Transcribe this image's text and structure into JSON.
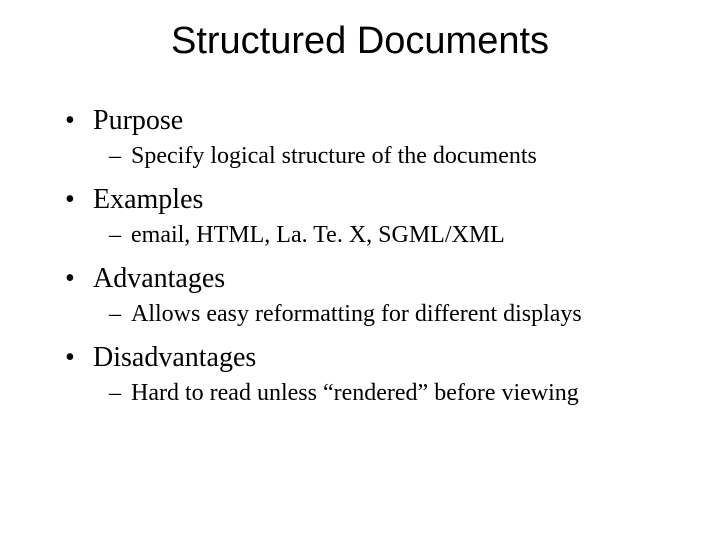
{
  "title": "Structured Documents",
  "items": [
    {
      "label": "Purpose",
      "subs": [
        "Specify logical structure of the documents"
      ]
    },
    {
      "label": "Examples",
      "subs": [
        "email, HTML, La. Te. X, SGML/XML"
      ]
    },
    {
      "label": "Advantages",
      "subs": [
        "Allows easy reformatting for different displays"
      ]
    },
    {
      "label": "Disadvantages",
      "subs": [
        "Hard to read unless “rendered” before viewing"
      ]
    }
  ]
}
